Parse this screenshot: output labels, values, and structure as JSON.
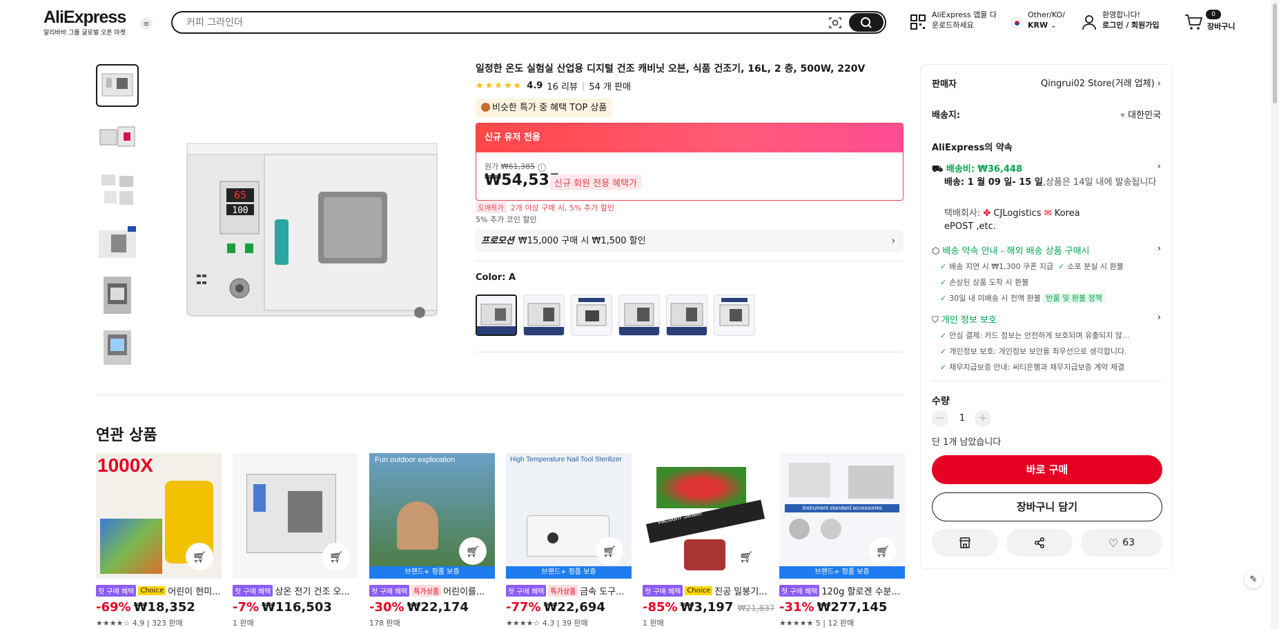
{
  "header": {
    "logo": "AliExpress",
    "logo_sub": "알리바바 그룹 글로벌 오픈 마켓",
    "search_placeholder": "커피 그라인더",
    "app_line1": "AliExpress 앱을 다",
    "app_line2": "운로드하세요",
    "region_line1": "Other/KO/",
    "region_line2": "KRW",
    "user_line1": "환영합니다!",
    "user_line2": "로그인 / 회원가입",
    "cart_count": "0",
    "cart_label": "장바구니"
  },
  "product": {
    "title": "일정한 온도 실험실 산업용 디지털 건조 캐비닛 오븐, 식품 건조기, 16L, 2 층, 500W, 220V",
    "rating": "4.9",
    "reviews": "16 리뷰",
    "sold": "54 개 판매",
    "top_tag": "비슷한 특가 중 혜택 TOP 상품",
    "new_user_band": "신규 유저 전용",
    "orig_label": "원가",
    "orig_price": "₩61,385",
    "price": "₩54,535",
    "new_badge": "신규 회원 전용 혜택가",
    "discount_tag": "도매특가",
    "discount_text": "2개 이상 구매 시, 5% 추가 할인",
    "coin_text": "5% 추가 코인 할인",
    "promo_label": "프로모션",
    "promo_text": "₩15,000 구매 시 ₩1,500 할인",
    "color_label": "Color: A",
    "oven_display_top": "65",
    "oven_display_bottom": "100"
  },
  "seller": {
    "seller_label": "판매자",
    "seller_name": "Qingrui02 Store(거래 업체)",
    "ship_to_label": "배송지:",
    "ship_to": "대한민국",
    "promise_title": "AliExpress의 약속",
    "shipping_fee": "배송비: ₩36,448",
    "delivery_date": "배송: 1 월 09 일- 15 일",
    "delivery_note": ",상품은 14일 내에 발송됩니다",
    "carrier_label": "택배회사:",
    "carrier1": "CJLogistics",
    "carrier2": "Korea",
    "carrier3": "ePOST ,etc.",
    "guarantee_title": "배송 약속 안내 - 해외 배송 상품 구매시",
    "g1": "배송 지연 시 ₩1,300 쿠폰 지급",
    "g2": "소포 분실 시 환불",
    "g3": "손상된 상품 도착 시 환불",
    "g4": "30일 내 미배송 시 전액 환불",
    "g4_badge": "반품 및 환불 정책",
    "privacy_title": "개인 정보 보호",
    "p1": "안심 결제: 카드 정보는 안전하게 보호되며 유출되지 않...",
    "p2": "개인정보 보호: 개인정보 보안을 최우선으로 생각합니다.",
    "p3": "채무지급보증 안내: 씨티은행과 채무지급보증 계약 체결",
    "qty_label": "수량",
    "qty": "1",
    "stock_note": "단 1개 남았습니다",
    "buy_now": "바로 구매",
    "add_cart": "장바구니 담기",
    "wish_count": "63"
  },
  "related": {
    "heading": "연관 상품",
    "items": [
      {
        "b1": "첫 구매 혜택",
        "b2": "Choice",
        "name": "어린이 현미...",
        "disc": "-69%",
        "price": "₩18,352",
        "orig": "",
        "meta": "★★★★☆ 4.9 | 323 판매",
        "strip": "",
        "img_text": "1000X"
      },
      {
        "b1": "첫 구매 혜택",
        "b2": "",
        "name": "상온 전기 건조 오...",
        "disc": "-7%",
        "price": "₩116,503",
        "orig": "",
        "meta": "1 판매",
        "strip": "",
        "img_text": ""
      },
      {
        "b1": "첫 구매 혜택",
        "b2": "특가상품",
        "name": "어린이를...",
        "disc": "-30%",
        "price": "₩22,174",
        "orig": "",
        "meta": "178 판매",
        "strip": "브랜드+ 정품 보증",
        "img_text": "Fun outdoor exploration"
      },
      {
        "b1": "첫 구매 혜택",
        "b2": "특가상품",
        "name": "금속 도구...",
        "disc": "-77%",
        "price": "₩22,694",
        "orig": "",
        "meta": "★★★★☆ 4.3 | 39 판매",
        "strip": "브랜드+ 정품 보증",
        "img_text": "High Temperature Nail Tool Sterilizer"
      },
      {
        "b1": "첫 구매 혜택",
        "b2": "Choice",
        "name": "진공 밀봉기...",
        "disc": "-85%",
        "price": "₩3,197",
        "orig": "₩21,837",
        "meta": "1 판매",
        "strip": "",
        "img_text": "Vacuum Sealer"
      },
      {
        "b1": "첫 구매 혜택",
        "b2": "",
        "name": "120g 할로겐 수분...",
        "disc": "-31%",
        "price": "₩277,145",
        "orig": "",
        "meta": "★★★★★ 5 | 12 판매",
        "strip": "브랜드+ 정품 보증",
        "img_text": "Instrument standard accessories"
      }
    ]
  },
  "colors": {
    "accent": "#e60023",
    "green": "#00a651",
    "dark": "#191919"
  }
}
